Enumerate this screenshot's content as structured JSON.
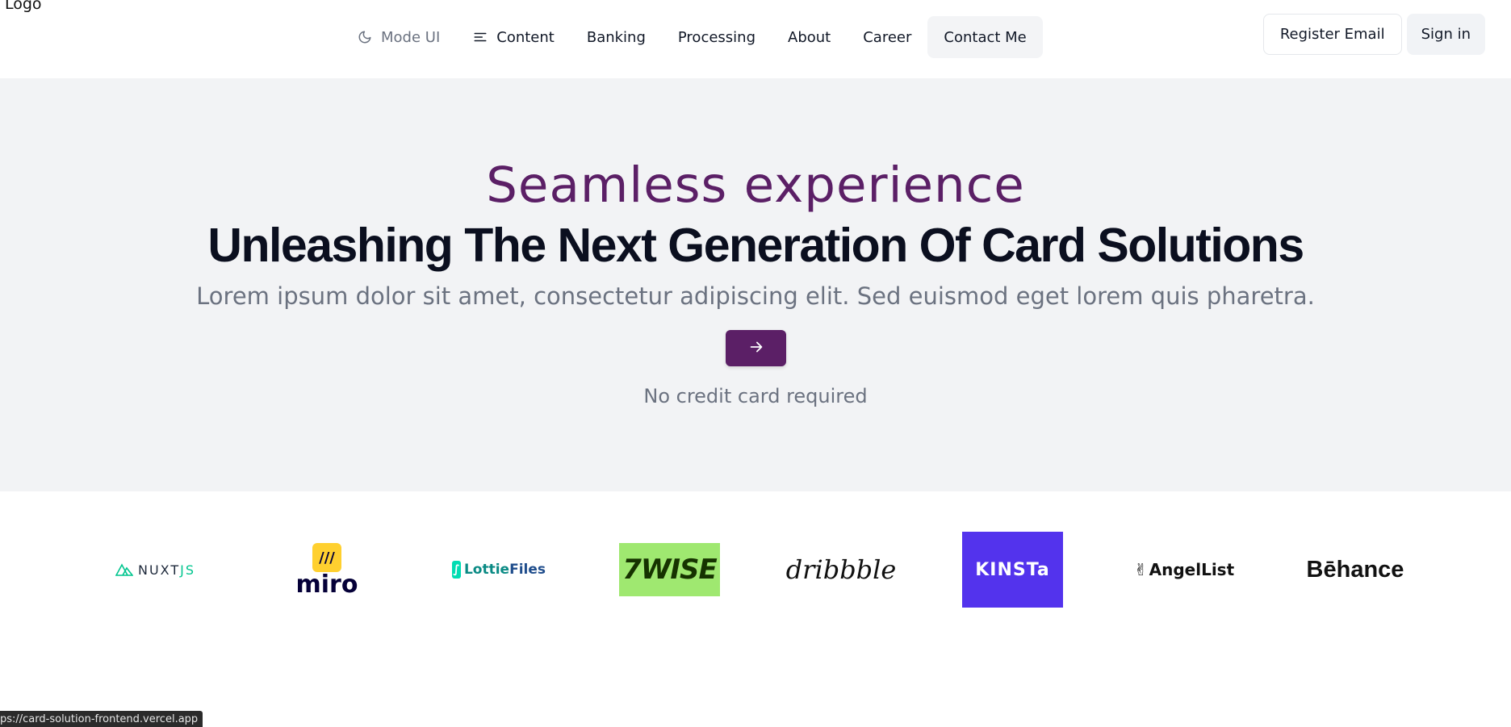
{
  "header": {
    "logo": "Logo",
    "nav": [
      {
        "label": "Mode UI",
        "icon": "moon-icon"
      },
      {
        "label": "Content",
        "icon": "menu-icon"
      },
      {
        "label": "Banking"
      },
      {
        "label": "Processing"
      },
      {
        "label": "About"
      },
      {
        "label": "Career"
      },
      {
        "label": "Contact Me",
        "active": true
      }
    ],
    "register_label": "Register Email",
    "signin_label": "Sign in"
  },
  "hero": {
    "eyebrow": "Seamless experience",
    "title": "Unleashing The Next Generation Of Card Solutions",
    "subtitle": "Lorem ipsum dolor sit amet, consectetur adipiscing elit. Sed euismod eget lorem quis pharetra.",
    "cta_icon": "arrow-right-icon",
    "note": "No credit card required"
  },
  "logos": {
    "nuxt": {
      "left": "NUXT",
      "right": "JS"
    },
    "miro": "miro",
    "lottie": {
      "left": "Lottie",
      "right": "Files"
    },
    "wise": "7WISE",
    "dribbble": "dribbble",
    "kinsta": "KINSTa",
    "angellist": "AngelList",
    "behance": "Bēhance"
  },
  "status_bar": "ps://card-solution-frontend.vercel.app",
  "colors": {
    "accent": "#5b1f66",
    "hero_bg": "#f2f3f5",
    "wise": "#9fe870",
    "kinsta": "#5333ed"
  }
}
